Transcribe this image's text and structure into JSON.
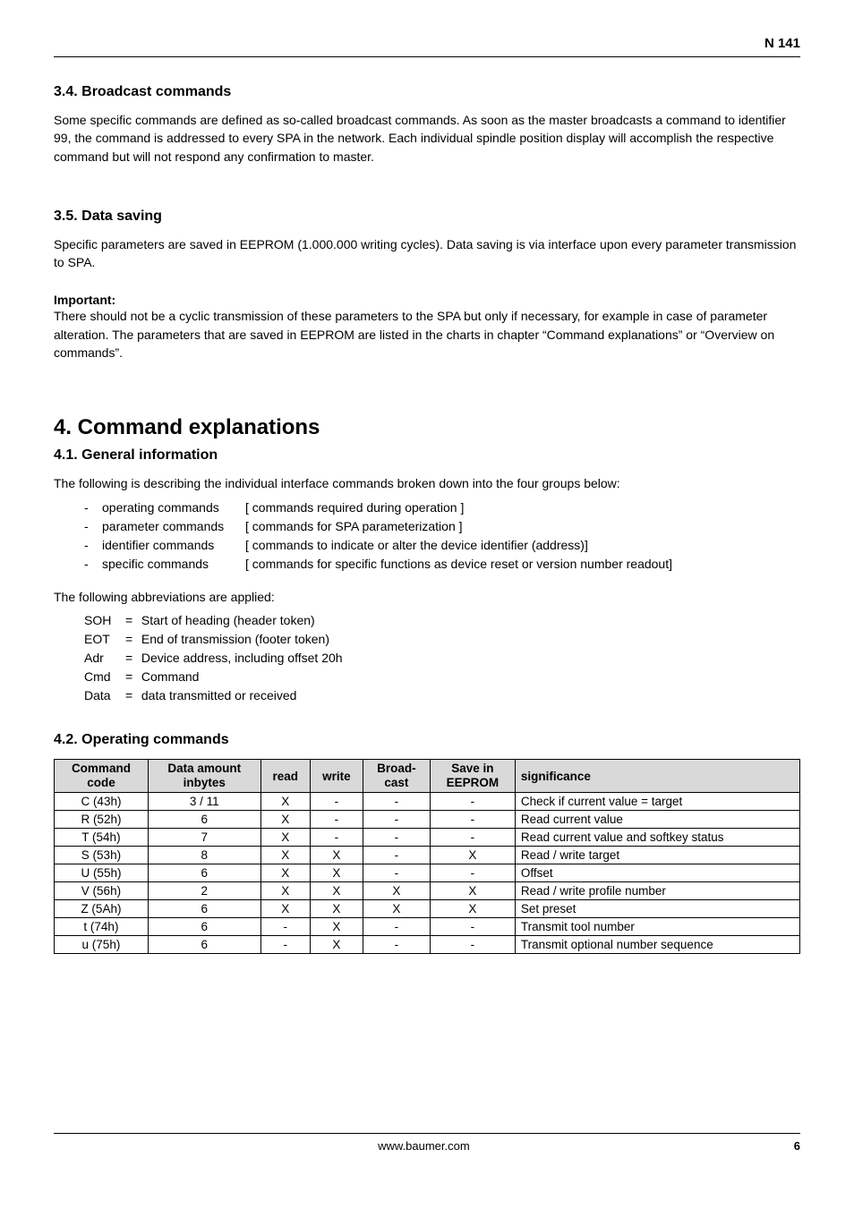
{
  "header": {
    "doc_id": "N 141"
  },
  "s34": {
    "heading": "3.4.  Broadcast commands",
    "body": "Some specific commands are defined as so-called broadcast commands. As soon as the master broadcasts a command to identifier 99, the command is addressed to every SPA in the network. Each individual spindle position display will accomplish the respective command but will not respond any confirmation to master."
  },
  "s35": {
    "heading": "3.5.  Data saving",
    "body": "Specific parameters are saved in EEPROM (1.000.000 writing cycles). Data saving is via interface upon every parameter transmission to SPA.",
    "important_label": "Important:",
    "important_body": "There should not be a cyclic transmission of these parameters to the SPA but only if necessary, for example in case of parameter alteration. The parameters that are saved in EEPROM are listed in the charts in chapter “Command explanations” or “Overview on commands”."
  },
  "s4": {
    "heading": "4. Command explanations"
  },
  "s41": {
    "heading": "4.1.  General information",
    "intro": "The following is describing the individual interface commands broken down into the four groups below:",
    "groups": [
      {
        "name": "operating commands",
        "desc": "[ commands required during operation ]"
      },
      {
        "name": "parameter commands",
        "desc": "[ commands for SPA parameterization ]"
      },
      {
        "name": "identifier commands",
        "desc": "[ commands to indicate or alter the device identifier (address)]"
      },
      {
        "name": "specific commands",
        "desc": "[ commands for specific functions as device reset or version number readout]"
      }
    ],
    "abbrev_intro": "The following abbreviations are applied:",
    "abbrevs": [
      {
        "key": "SOH",
        "desc": "Start of heading (header token)"
      },
      {
        "key": "EOT",
        "desc": "End of transmission (footer token)"
      },
      {
        "key": "Adr",
        "desc": "Device address, including offset 20h"
      },
      {
        "key": "Cmd",
        "desc": "Command"
      },
      {
        "key": "Data",
        "desc": "data transmitted or received"
      }
    ]
  },
  "s42": {
    "heading": "4.2.  Operating commands",
    "columns": {
      "code1": "Command",
      "code2": "code",
      "data1": "Data amount",
      "data2": "inbytes",
      "read": "read",
      "write": "write",
      "bc1": "Broad-",
      "bc2": "cast",
      "save1": "Save in",
      "save2": "EEPROM",
      "sig": "significance"
    },
    "rows": [
      {
        "code": "C  (43h)",
        "data": "3 / 11",
        "read": "X",
        "write": "-",
        "bc": "-",
        "save": "-",
        "sig": "Check if current value = target"
      },
      {
        "code": "R  (52h)",
        "data": "6",
        "read": "X",
        "write": "-",
        "bc": "-",
        "save": "-",
        "sig": "Read current value"
      },
      {
        "code": "T  (54h)",
        "data": "7",
        "read": "X",
        "write": "-",
        "bc": "-",
        "save": "-",
        "sig": "Read current value and softkey status"
      },
      {
        "code": "S  (53h)",
        "data": "8",
        "read": "X",
        "write": "X",
        "bc": "-",
        "save": "X",
        "sig": "Read  / write target"
      },
      {
        "code": "U  (55h)",
        "data": "6",
        "read": "X",
        "write": "X",
        "bc": "-",
        "save": "-",
        "sig": "Offset"
      },
      {
        "code": "V  (56h)",
        "data": "2",
        "read": "X",
        "write": "X",
        "bc": "X",
        "save": "X",
        "sig": "Read / write profile number"
      },
      {
        "code": "Z  (5Ah)",
        "data": "6",
        "read": "X",
        "write": "X",
        "bc": "X",
        "save": "X",
        "sig": "Set preset"
      },
      {
        "code": "t  (74h)",
        "data": "6",
        "read": "-",
        "write": "X",
        "bc": "-",
        "save": "-",
        "sig": "Transmit tool number"
      },
      {
        "code": "u  (75h)",
        "data": "6",
        "read": "-",
        "write": "X",
        "bc": "-",
        "save": "-",
        "sig": "Transmit optional number sequence"
      }
    ]
  },
  "footer": {
    "site": "www.baumer.com",
    "page": "6"
  }
}
